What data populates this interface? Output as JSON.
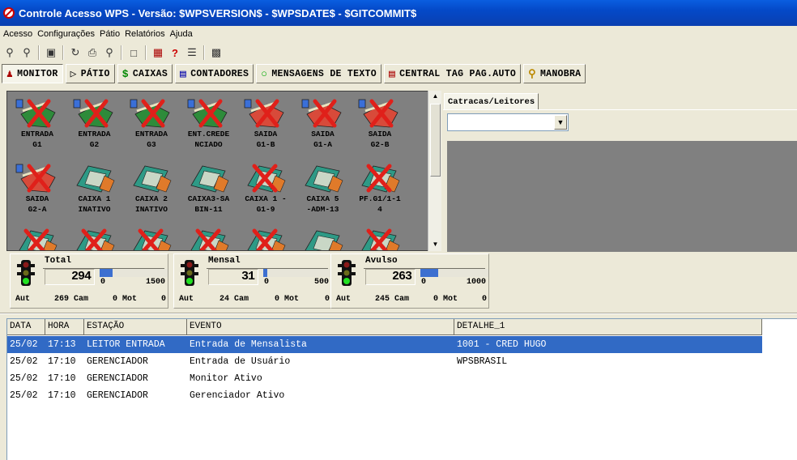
{
  "window": {
    "title": "Controle Acesso WPS - Versão: $WPSVERSION$ - $WPSDATE$ - $GITCOMMIT$"
  },
  "menu": [
    "Acesso",
    "Configurações",
    "Pátio",
    "Relatórios",
    "Ajuda"
  ],
  "toolbar_icons": [
    "lock-icon",
    "lock-icon",
    "monitor-icon",
    "refresh-icon",
    "printer-icon",
    "magnifier-icon",
    "document-icon",
    "card-icon",
    "help-icon",
    "exit-icon"
  ],
  "tabs": [
    {
      "label": "MONITOR",
      "icon": "people-icon",
      "active": true
    },
    {
      "label": "PÁTIO",
      "icon": "car-icon"
    },
    {
      "label": "CAIXAS",
      "icon": "dollar-icon"
    },
    {
      "label": "CONTADORES",
      "icon": "counter-icon"
    },
    {
      "label": "MENSAGENS DE TEXTO",
      "icon": "message-icon"
    },
    {
      "label": "CENTRAL TAG PAG.AUTO",
      "icon": "tag-icon"
    },
    {
      "label": "MANOBRA",
      "icon": "key-icon"
    }
  ],
  "devices": [
    {
      "label": "ENTRADA\nG1",
      "kind": "gate"
    },
    {
      "label": "ENTRADA\nG2",
      "kind": "gate"
    },
    {
      "label": "ENTRADA\nG3",
      "kind": "gate"
    },
    {
      "label": "ENT.CREDE\nNCIADO",
      "kind": "gate"
    },
    {
      "label": "SAIDA\nG1-B",
      "kind": "gate-red"
    },
    {
      "label": "SAIDA\nG1-A",
      "kind": "gate-red"
    },
    {
      "label": "SAIDA\nG2-B",
      "kind": "gate-red"
    },
    {
      "label": "SAIDA\nG2-A",
      "kind": "gate-red"
    },
    {
      "label": "CAIXA 1\nINATIVO",
      "kind": "cash"
    },
    {
      "label": "CAIXA 2\nINATIVO",
      "kind": "cash"
    },
    {
      "label": "CAIXA3-SA\nBIN-11",
      "kind": "cash"
    },
    {
      "label": "CAIXA 1 -\nG1-9",
      "kind": "cash-x"
    },
    {
      "label": "CAIXA 5\n-ADM-13",
      "kind": "cash"
    },
    {
      "label": "PF.G1/1-1\n4",
      "kind": "cash-x"
    },
    {
      "label": "",
      "kind": "cash-x"
    },
    {
      "label": "",
      "kind": "cash-x"
    },
    {
      "label": "",
      "kind": "cash-x"
    },
    {
      "label": "",
      "kind": "cash-x"
    },
    {
      "label": "",
      "kind": "cash-x"
    },
    {
      "label": "",
      "kind": "cash"
    },
    {
      "label": "",
      "kind": "cash-x"
    }
  ],
  "right_panel": {
    "tab": "Catracas/Leitores",
    "select_value": ""
  },
  "counters": [
    {
      "title": "Total",
      "value": "294",
      "min": "0",
      "max": "1500",
      "fill": 0.196,
      "aut_label": "Aut",
      "cam": "269 Cam",
      "mot": "0 Mot",
      "last": "0"
    },
    {
      "title": "Mensal",
      "value": "31",
      "min": "0",
      "max": "500",
      "fill": 0.062,
      "aut_label": "Aut",
      "cam": "24 Cam",
      "mot": "0 Mot",
      "last": "0"
    },
    {
      "title": "Avulso",
      "value": "263",
      "min": "0",
      "max": "1000",
      "fill": 0.263,
      "aut_label": "Aut",
      "cam": "245 Cam",
      "mot": "0 Mot",
      "last": "0"
    }
  ],
  "grid": {
    "headers": [
      "DATA",
      "HORA",
      "ESTAÇÃO",
      "EVENTO",
      "DETALHE_1"
    ],
    "rows": [
      {
        "date": "25/02",
        "time": "17:13",
        "station": "LEITOR ENTRADA",
        "event": "Entrada de Mensalista",
        "detail": "1001 - CRED HUGO",
        "selected": true
      },
      {
        "date": "25/02",
        "time": "17:10",
        "station": "GERENCIADOR",
        "event": "Entrada de Usuário",
        "detail": "WPSBRASIL"
      },
      {
        "date": "25/02",
        "time": "17:10",
        "station": "GERENCIADOR",
        "event": "Monitor Ativo",
        "detail": ""
      },
      {
        "date": "25/02",
        "time": "17:10",
        "station": "GERENCIADOR",
        "event": "Gerenciador Ativo",
        "detail": ""
      }
    ]
  },
  "colors": {
    "selection": "#316ac5",
    "title_bar": "#0a5ee0",
    "pane_gray": "#808080",
    "counter_bar": "#3c6fd0"
  }
}
